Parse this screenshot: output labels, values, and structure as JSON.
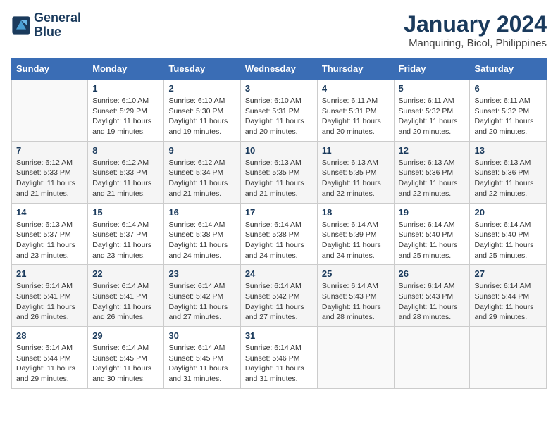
{
  "logo": {
    "line1": "General",
    "line2": "Blue"
  },
  "title": "January 2024",
  "subtitle": "Manquiring, Bicol, Philippines",
  "days_of_week": [
    "Sunday",
    "Monday",
    "Tuesday",
    "Wednesday",
    "Thursday",
    "Friday",
    "Saturday"
  ],
  "weeks": [
    [
      {
        "day": "",
        "info": ""
      },
      {
        "day": "1",
        "info": "Sunrise: 6:10 AM\nSunset: 5:29 PM\nDaylight: 11 hours and 19 minutes."
      },
      {
        "day": "2",
        "info": "Sunrise: 6:10 AM\nSunset: 5:30 PM\nDaylight: 11 hours and 19 minutes."
      },
      {
        "day": "3",
        "info": "Sunrise: 6:10 AM\nSunset: 5:31 PM\nDaylight: 11 hours and 20 minutes."
      },
      {
        "day": "4",
        "info": "Sunrise: 6:11 AM\nSunset: 5:31 PM\nDaylight: 11 hours and 20 minutes."
      },
      {
        "day": "5",
        "info": "Sunrise: 6:11 AM\nSunset: 5:32 PM\nDaylight: 11 hours and 20 minutes."
      },
      {
        "day": "6",
        "info": "Sunrise: 6:11 AM\nSunset: 5:32 PM\nDaylight: 11 hours and 20 minutes."
      }
    ],
    [
      {
        "day": "7",
        "info": "Sunrise: 6:12 AM\nSunset: 5:33 PM\nDaylight: 11 hours and 21 minutes."
      },
      {
        "day": "8",
        "info": "Sunrise: 6:12 AM\nSunset: 5:33 PM\nDaylight: 11 hours and 21 minutes."
      },
      {
        "day": "9",
        "info": "Sunrise: 6:12 AM\nSunset: 5:34 PM\nDaylight: 11 hours and 21 minutes."
      },
      {
        "day": "10",
        "info": "Sunrise: 6:13 AM\nSunset: 5:35 PM\nDaylight: 11 hours and 21 minutes."
      },
      {
        "day": "11",
        "info": "Sunrise: 6:13 AM\nSunset: 5:35 PM\nDaylight: 11 hours and 22 minutes."
      },
      {
        "day": "12",
        "info": "Sunrise: 6:13 AM\nSunset: 5:36 PM\nDaylight: 11 hours and 22 minutes."
      },
      {
        "day": "13",
        "info": "Sunrise: 6:13 AM\nSunset: 5:36 PM\nDaylight: 11 hours and 22 minutes."
      }
    ],
    [
      {
        "day": "14",
        "info": "Sunrise: 6:13 AM\nSunset: 5:37 PM\nDaylight: 11 hours and 23 minutes."
      },
      {
        "day": "15",
        "info": "Sunrise: 6:14 AM\nSunset: 5:37 PM\nDaylight: 11 hours and 23 minutes."
      },
      {
        "day": "16",
        "info": "Sunrise: 6:14 AM\nSunset: 5:38 PM\nDaylight: 11 hours and 24 minutes."
      },
      {
        "day": "17",
        "info": "Sunrise: 6:14 AM\nSunset: 5:38 PM\nDaylight: 11 hours and 24 minutes."
      },
      {
        "day": "18",
        "info": "Sunrise: 6:14 AM\nSunset: 5:39 PM\nDaylight: 11 hours and 24 minutes."
      },
      {
        "day": "19",
        "info": "Sunrise: 6:14 AM\nSunset: 5:40 PM\nDaylight: 11 hours and 25 minutes."
      },
      {
        "day": "20",
        "info": "Sunrise: 6:14 AM\nSunset: 5:40 PM\nDaylight: 11 hours and 25 minutes."
      }
    ],
    [
      {
        "day": "21",
        "info": "Sunrise: 6:14 AM\nSunset: 5:41 PM\nDaylight: 11 hours and 26 minutes."
      },
      {
        "day": "22",
        "info": "Sunrise: 6:14 AM\nSunset: 5:41 PM\nDaylight: 11 hours and 26 minutes."
      },
      {
        "day": "23",
        "info": "Sunrise: 6:14 AM\nSunset: 5:42 PM\nDaylight: 11 hours and 27 minutes."
      },
      {
        "day": "24",
        "info": "Sunrise: 6:14 AM\nSunset: 5:42 PM\nDaylight: 11 hours and 27 minutes."
      },
      {
        "day": "25",
        "info": "Sunrise: 6:14 AM\nSunset: 5:43 PM\nDaylight: 11 hours and 28 minutes."
      },
      {
        "day": "26",
        "info": "Sunrise: 6:14 AM\nSunset: 5:43 PM\nDaylight: 11 hours and 28 minutes."
      },
      {
        "day": "27",
        "info": "Sunrise: 6:14 AM\nSunset: 5:44 PM\nDaylight: 11 hours and 29 minutes."
      }
    ],
    [
      {
        "day": "28",
        "info": "Sunrise: 6:14 AM\nSunset: 5:44 PM\nDaylight: 11 hours and 29 minutes."
      },
      {
        "day": "29",
        "info": "Sunrise: 6:14 AM\nSunset: 5:45 PM\nDaylight: 11 hours and 30 minutes."
      },
      {
        "day": "30",
        "info": "Sunrise: 6:14 AM\nSunset: 5:45 PM\nDaylight: 11 hours and 31 minutes."
      },
      {
        "day": "31",
        "info": "Sunrise: 6:14 AM\nSunset: 5:46 PM\nDaylight: 11 hours and 31 minutes."
      },
      {
        "day": "",
        "info": ""
      },
      {
        "day": "",
        "info": ""
      },
      {
        "day": "",
        "info": ""
      }
    ]
  ]
}
